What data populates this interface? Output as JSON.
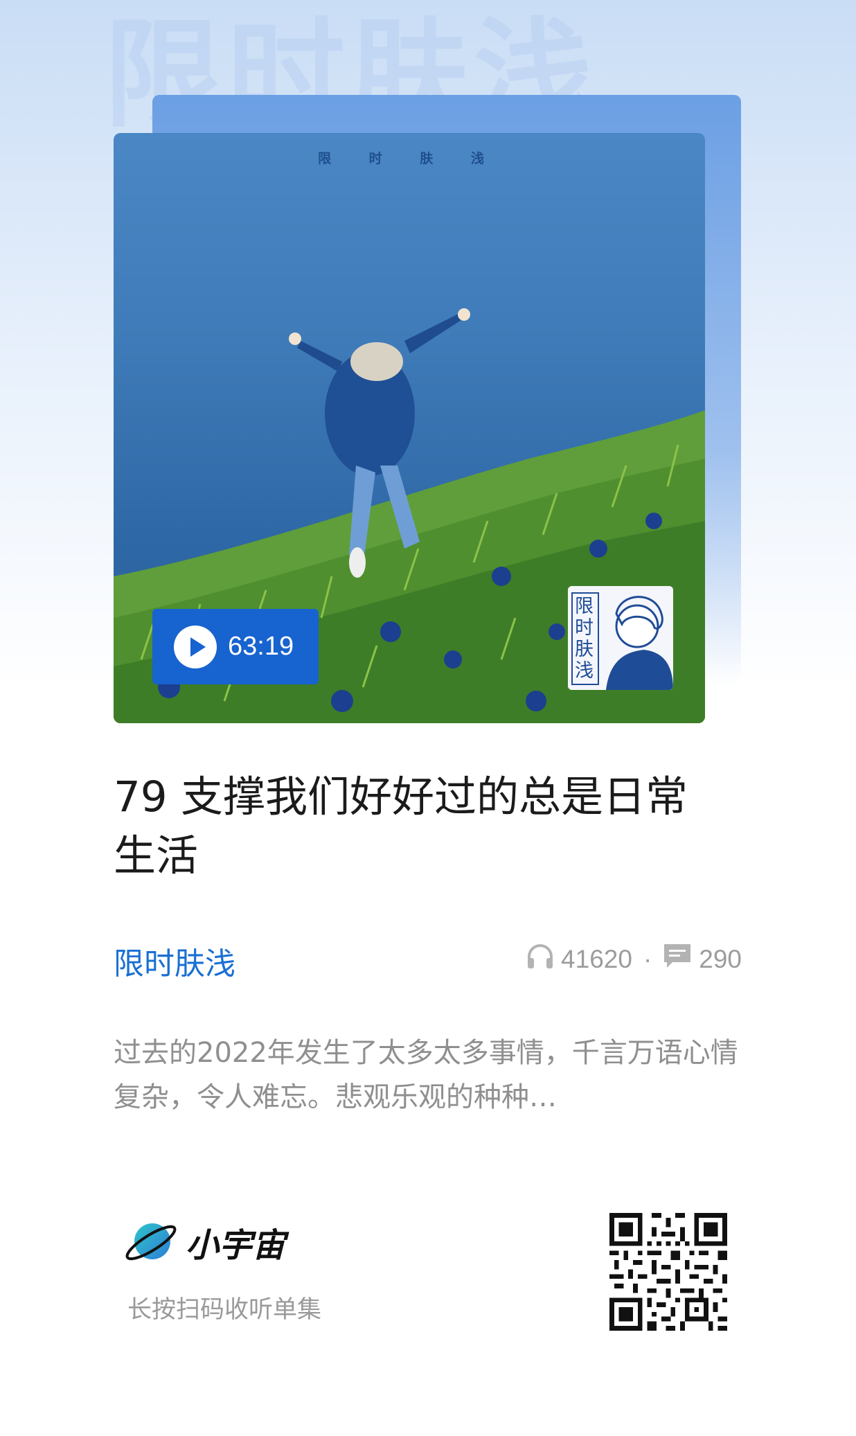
{
  "background": {
    "watermark": "限时肤浅"
  },
  "cover": {
    "title": "限 时 肤 浅",
    "duration": "63:19",
    "thumb_title": "限时肤浅"
  },
  "episode": {
    "title": "79 支撑我们好好过的总是日常生活"
  },
  "podcast": {
    "name": "限时肤浅"
  },
  "stats": {
    "plays": "41620",
    "separator": "·",
    "comments": "290"
  },
  "description": "过去的2022年发生了太多太多事情，千言万语心情复杂，令人难忘。悲观乐观的种种…",
  "brand": {
    "name": "小宇宙",
    "scan_hint": "长按扫码收听单集"
  },
  "colors": {
    "accent": "#1a6fd3",
    "play_badge": "#1763cf"
  },
  "icons": [
    "play-icon",
    "headphones-icon",
    "comment-icon",
    "planet-logo-icon",
    "qr-code"
  ]
}
